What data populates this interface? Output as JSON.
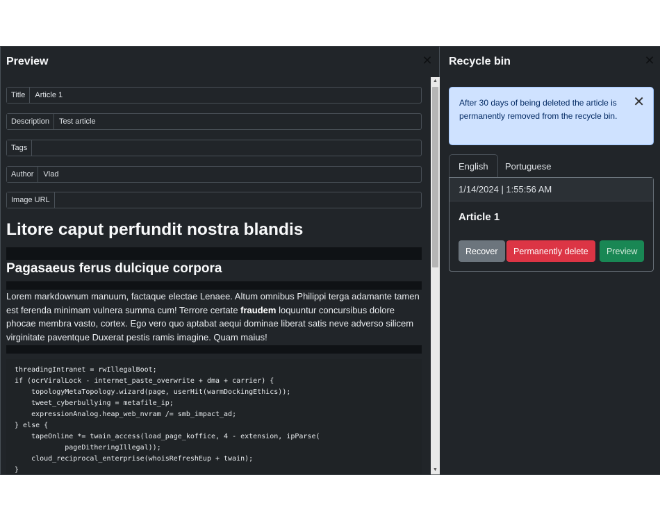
{
  "preview": {
    "title": "Preview",
    "fields": [
      {
        "label": "Title",
        "value": "Article 1"
      },
      {
        "label": "Description",
        "value": "Test article"
      },
      {
        "label": "Tags",
        "value": ""
      },
      {
        "label": "Author",
        "value": "Vlad"
      },
      {
        "label": "Image URL",
        "value": ""
      }
    ],
    "heading1": "Litore caput perfundit nostra blandis",
    "heading2": "Pagasaeus ferus dulcique corpora",
    "paragraph_before": "Lorem markdownum manuum, factaque electae Lenaee. Altum omnibus Philippi terga adamante tamen est ferenda minimam vulnera summa cum! Terrore certate ",
    "paragraph_bold": "fraudem",
    "paragraph_after": " loquuntur concursibus dolore phocae membra vasto, cortex. Ego vero quo aptabat aequi dominae liberat satis neve adverso silicem virginitate paventque Duxerat pestis ramis imagine. Quam maius!",
    "code": "threadingIntranet = rwIllegalBoot;\nif (ocrViralLock - internet_paste_overwrite + dma + carrier) {\n    topologyMetaTopology.wizard(page, userHit(warmDockingEthics));\n    tweet_cyberbullying = metafile_ip;\n    expressionAnalog.heap_web_nvram /= smb_impact_ad;\n} else {\n    tapeOnline *= twain_access(load_page_koffice, 4 - extension, ipParse(\n            pageDitheringIllegal));\n    cloud_reciprocal_enterprise(whoisRefreshEup + twain);\n}"
  },
  "recycle_bin": {
    "title": "Recycle bin",
    "alert": "After 30 days of being deleted the article is permanently removed from the recycle bin.",
    "tabs": [
      {
        "label": "English",
        "active": true
      },
      {
        "label": "Portuguese",
        "active": false
      }
    ],
    "card": {
      "timestamp": "1/14/2024 | 1:55:56 AM",
      "title": "Article 1",
      "buttons": {
        "recover": "Recover",
        "delete": "Permanently delete",
        "preview": "Preview"
      }
    }
  },
  "colors": {
    "background": "#212529",
    "alert_bg": "#cfe2ff",
    "danger": "#dc3545",
    "success": "#198754",
    "secondary": "#6c757d"
  },
  "icons": [
    "close-icon",
    "scroll-up-icon",
    "scroll-down-icon"
  ]
}
